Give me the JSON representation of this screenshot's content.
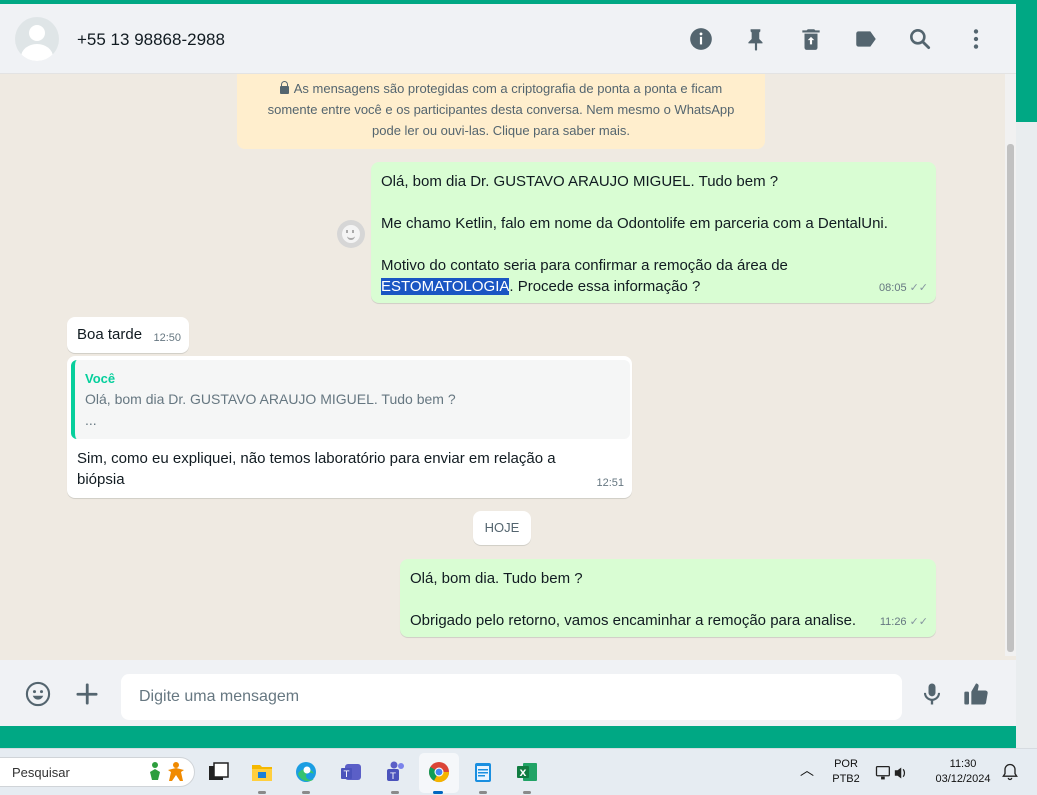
{
  "header": {
    "contact_name": "+55 13 98868-2988"
  },
  "encryption_notice": {
    "line1": "As mensagens são protegidas com a criptografia de ponta a ponta e ficam",
    "line2": "somente entre você e os participantes desta conversa. Nem mesmo o WhatsApp",
    "line3": "pode ler ou ouvi-las. Clique para saber mais."
  },
  "messages": {
    "m1": {
      "line1": "Olá, bom dia Dr. GUSTAVO ARAUJO MIGUEL. Tudo bem ?",
      "line2": "Me chamo Ketlin, falo em nome da Odontolife em parceria com a DentalUni.",
      "line3": "Motivo do contato seria para confirmar a remoção da área de",
      "highlight": "ESTOMATOLOGIA",
      "line4_rest": ". Procede essa informação ?",
      "time": "08:05"
    },
    "m2": {
      "text": "Boa tarde",
      "time": "12:50"
    },
    "m3": {
      "quote_author": "Você",
      "quote_line1": "Olá, bom dia Dr. GUSTAVO ARAUJO MIGUEL. Tudo bem ?",
      "quote_line2": "...",
      "line1": "Sim, como eu expliquei, não temos laboratório para enviar em relação a",
      "line2": "biópsia",
      "time": "12:51"
    },
    "m4": {
      "line1": "Olá, bom dia. Tudo bem ?",
      "line2": "Obrigado pelo retorno, vamos encaminhar a remoção para analise.",
      "time": "11:26"
    }
  },
  "date_divider": "HOJE",
  "composer": {
    "placeholder": "Digite uma mensagem"
  },
  "taskbar": {
    "search_placeholder": "Pesquisar",
    "lang_line1": "POR",
    "lang_line2": "PTB2",
    "clock_time": "11:30",
    "clock_date": "03/12/2024"
  },
  "colors": {
    "accent": "#00a884",
    "outgoing_bubble": "#d9fdd3",
    "incoming_bubble": "#ffffff",
    "selection_highlight": "#1a55c3"
  }
}
